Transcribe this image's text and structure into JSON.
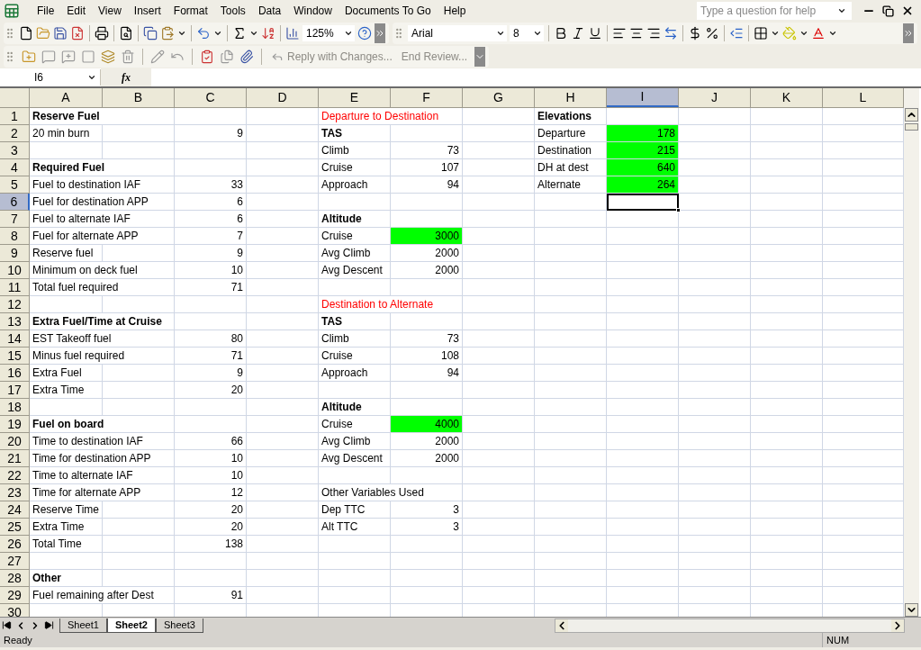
{
  "menu_bar": {
    "items": [
      "File",
      "Edit",
      "View",
      "Insert",
      "Format",
      "Tools",
      "Data",
      "Window",
      "Documents To Go",
      "Help"
    ]
  },
  "help_box": {
    "placeholder": "Type a question for help"
  },
  "standard_toolbar": {
    "zoom": "125%"
  },
  "formatting_toolbar": {
    "font": "Arial",
    "font_size": "8"
  },
  "reviewing_toolbar": {
    "buttons": [
      "Reply with Changes...",
      "End Review..."
    ]
  },
  "formula_bar": {
    "name_box": "I6",
    "function_label": "fx"
  },
  "sheet": {
    "columns": [
      {
        "label": "A",
        "selected": false
      },
      {
        "label": "B",
        "selected": false
      },
      {
        "label": "C",
        "selected": false
      },
      {
        "label": "D",
        "selected": false
      },
      {
        "label": "E",
        "selected": false
      },
      {
        "label": "F",
        "selected": false
      },
      {
        "label": "G",
        "selected": false
      },
      {
        "label": "H",
        "selected": false
      },
      {
        "label": "I",
        "selected": true
      },
      {
        "label": "J",
        "selected": false
      },
      {
        "label": "K",
        "selected": false
      },
      {
        "label": "L",
        "selected": false
      }
    ],
    "rows": [
      {
        "number": "1",
        "selected": false,
        "cells": {
          "a": {
            "text": "Reserve Fuel",
            "kind": "text",
            "bold": true,
            "highlighted": false
          },
          "e": {
            "text": "Departure to Destination",
            "kind": "text",
            "bold": false,
            "highlighted": false,
            "color": "#ff0000"
          },
          "h": {
            "text": "Elevations",
            "kind": "text",
            "bold": true,
            "highlighted": false
          }
        }
      },
      {
        "number": "2",
        "selected": false,
        "cells": {
          "a": {
            "text": "20 min burn",
            "kind": "text",
            "bold": false,
            "highlighted": false
          },
          "c": {
            "text": "9",
            "kind": "number",
            "bold": false,
            "highlighted": false
          },
          "e": {
            "text": "TAS",
            "kind": "text",
            "bold": true,
            "highlighted": false
          },
          "h": {
            "text": "Departure",
            "kind": "text",
            "bold": false,
            "highlighted": false
          },
          "i": {
            "text": "178",
            "kind": "number",
            "bold": false,
            "highlighted": true
          }
        }
      },
      {
        "number": "3",
        "selected": false,
        "cells": {
          "e": {
            "text": "Climb",
            "kind": "text",
            "bold": false,
            "highlighted": false
          },
          "f": {
            "text": "73",
            "kind": "number",
            "bold": false,
            "highlighted": false
          },
          "h": {
            "text": "Destination",
            "kind": "text",
            "bold": false,
            "highlighted": false
          },
          "i": {
            "text": "215",
            "kind": "number",
            "bold": false,
            "highlighted": true
          }
        }
      },
      {
        "number": "4",
        "selected": false,
        "cells": {
          "a": {
            "text": "Required Fuel",
            "kind": "text",
            "bold": true,
            "highlighted": false
          },
          "e": {
            "text": "Cruise",
            "kind": "text",
            "bold": false,
            "highlighted": false
          },
          "f": {
            "text": "107",
            "kind": "number",
            "bold": false,
            "highlighted": false
          },
          "h": {
            "text": "DH at dest",
            "kind": "text",
            "bold": false,
            "highlighted": false
          },
          "i": {
            "text": "640",
            "kind": "number",
            "bold": false,
            "highlighted": true
          }
        }
      },
      {
        "number": "5",
        "selected": false,
        "cells": {
          "a": {
            "text": "Fuel to destination IAF",
            "kind": "text",
            "bold": false,
            "highlighted": false
          },
          "c": {
            "text": "33",
            "kind": "number",
            "bold": false,
            "highlighted": false
          },
          "e": {
            "text": "Approach",
            "kind": "text",
            "bold": false,
            "highlighted": false
          },
          "f": {
            "text": "94",
            "kind": "number",
            "bold": false,
            "highlighted": false
          },
          "h": {
            "text": "Alternate",
            "kind": "text",
            "bold": false,
            "highlighted": false
          },
          "i": {
            "text": "264",
            "kind": "number",
            "bold": false,
            "highlighted": true
          }
        }
      },
      {
        "number": "6",
        "selected": true,
        "cells": {
          "a": {
            "text": "Fuel for destination APP",
            "kind": "text",
            "bold": false,
            "highlighted": false
          },
          "c": {
            "text": "6",
            "kind": "number",
            "bold": false,
            "highlighted": false
          }
        }
      },
      {
        "number": "7",
        "selected": false,
        "cells": {
          "a": {
            "text": "Fuel to alternate IAF",
            "kind": "text",
            "bold": false,
            "highlighted": false
          },
          "c": {
            "text": "6",
            "kind": "number",
            "bold": false,
            "highlighted": false
          },
          "e": {
            "text": "Altitude",
            "kind": "text",
            "bold": true,
            "highlighted": false
          }
        }
      },
      {
        "number": "8",
        "selected": false,
        "cells": {
          "a": {
            "text": "Fuel for alternate APP",
            "kind": "text",
            "bold": false,
            "highlighted": false
          },
          "c": {
            "text": "7",
            "kind": "number",
            "bold": false,
            "highlighted": false
          },
          "e": {
            "text": "Cruise",
            "kind": "text",
            "bold": false,
            "highlighted": false
          },
          "f": {
            "text": "3000",
            "kind": "number",
            "bold": false,
            "highlighted": true
          }
        }
      },
      {
        "number": "9",
        "selected": false,
        "cells": {
          "a": {
            "text": "Reserve fuel",
            "kind": "text",
            "bold": false,
            "highlighted": false
          },
          "c": {
            "text": "9",
            "kind": "number",
            "bold": false,
            "highlighted": false
          },
          "e": {
            "text": "Avg Climb",
            "kind": "text",
            "bold": false,
            "highlighted": false
          },
          "f": {
            "text": "2000",
            "kind": "number",
            "bold": false,
            "highlighted": false
          }
        }
      },
      {
        "number": "10",
        "selected": false,
        "cells": {
          "a": {
            "text": "Minimum on deck fuel",
            "kind": "text",
            "bold": false,
            "highlighted": false
          },
          "c": {
            "text": "10",
            "kind": "number",
            "bold": false,
            "highlighted": false
          },
          "e": {
            "text": "Avg Descent",
            "kind": "text",
            "bold": false,
            "highlighted": false
          },
          "f": {
            "text": "2000",
            "kind": "number",
            "bold": false,
            "highlighted": false
          }
        }
      },
      {
        "number": "11",
        "selected": false,
        "cells": {
          "a": {
            "text": "Total fuel required",
            "kind": "text",
            "bold": false,
            "highlighted": false
          },
          "c": {
            "text": "71",
            "kind": "number",
            "bold": false,
            "highlighted": false
          }
        }
      },
      {
        "number": "12",
        "selected": false,
        "cells": {
          "e": {
            "text": "Destination to Alternate",
            "kind": "text",
            "bold": false,
            "highlighted": false,
            "color": "#ff0000"
          }
        }
      },
      {
        "number": "13",
        "selected": false,
        "cells": {
          "a": {
            "text": "Extra Fuel/Time at Cruise",
            "kind": "text",
            "bold": true,
            "highlighted": false
          },
          "e": {
            "text": "TAS",
            "kind": "text",
            "bold": true,
            "highlighted": false
          }
        }
      },
      {
        "number": "14",
        "selected": false,
        "cells": {
          "a": {
            "text": "EST Takeoff fuel",
            "kind": "text",
            "bold": false,
            "highlighted": false
          },
          "c": {
            "text": "80",
            "kind": "number",
            "bold": false,
            "highlighted": false
          },
          "e": {
            "text": "Climb",
            "kind": "text",
            "bold": false,
            "highlighted": false
          },
          "f": {
            "text": "73",
            "kind": "number",
            "bold": false,
            "highlighted": false
          }
        }
      },
      {
        "number": "15",
        "selected": false,
        "cells": {
          "a": {
            "text": "Minus fuel required",
            "kind": "text",
            "bold": false,
            "highlighted": false
          },
          "c": {
            "text": "71",
            "kind": "number",
            "bold": false,
            "highlighted": false
          },
          "e": {
            "text": "Cruise",
            "kind": "text",
            "bold": false,
            "highlighted": false
          },
          "f": {
            "text": "108",
            "kind": "number",
            "bold": false,
            "highlighted": false
          }
        }
      },
      {
        "number": "16",
        "selected": false,
        "cells": {
          "a": {
            "text": "Extra Fuel",
            "kind": "text",
            "bold": false,
            "highlighted": false
          },
          "c": {
            "text": "9",
            "kind": "number",
            "bold": false,
            "highlighted": false
          },
          "e": {
            "text": "Approach",
            "kind": "text",
            "bold": false,
            "highlighted": false
          },
          "f": {
            "text": "94",
            "kind": "number",
            "bold": false,
            "highlighted": false
          }
        }
      },
      {
        "number": "17",
        "selected": false,
        "cells": {
          "a": {
            "text": "Extra Time",
            "kind": "text",
            "bold": false,
            "highlighted": false
          },
          "c": {
            "text": "20",
            "kind": "number",
            "bold": false,
            "highlighted": false
          }
        }
      },
      {
        "number": "18",
        "selected": false,
        "cells": {
          "e": {
            "text": "Altitude",
            "kind": "text",
            "bold": true,
            "highlighted": false
          }
        }
      },
      {
        "number": "19",
        "selected": false,
        "cells": {
          "a": {
            "text": "Fuel on board",
            "kind": "text",
            "bold": true,
            "highlighted": false
          },
          "e": {
            "text": "Cruise",
            "kind": "text",
            "bold": false,
            "highlighted": false
          },
          "f": {
            "text": "4000",
            "kind": "number",
            "bold": false,
            "highlighted": true
          }
        }
      },
      {
        "number": "20",
        "selected": false,
        "cells": {
          "a": {
            "text": "Time to destination IAF",
            "kind": "text",
            "bold": false,
            "highlighted": false
          },
          "c": {
            "text": "66",
            "kind": "number",
            "bold": false,
            "highlighted": false
          },
          "e": {
            "text": "Avg Climb",
            "kind": "text",
            "bold": false,
            "highlighted": false
          },
          "f": {
            "text": "2000",
            "kind": "number",
            "bold": false,
            "highlighted": false
          }
        }
      },
      {
        "number": "21",
        "selected": false,
        "cells": {
          "a": {
            "text": "Time for destination APP",
            "kind": "text",
            "bold": false,
            "highlighted": false
          },
          "c": {
            "text": "10",
            "kind": "number",
            "bold": false,
            "highlighted": false
          },
          "e": {
            "text": "Avg Descent",
            "kind": "text",
            "bold": false,
            "highlighted": false
          },
          "f": {
            "text": "2000",
            "kind": "number",
            "bold": false,
            "highlighted": false
          }
        }
      },
      {
        "number": "22",
        "selected": false,
        "cells": {
          "a": {
            "text": "Time to alternate IAF",
            "kind": "text",
            "bold": false,
            "highlighted": false
          },
          "c": {
            "text": "10",
            "kind": "number",
            "bold": false,
            "highlighted": false
          }
        }
      },
      {
        "number": "23",
        "selected": false,
        "cells": {
          "a": {
            "text": "Time for alternate APP",
            "kind": "text",
            "bold": false,
            "highlighted": false
          },
          "c": {
            "text": "12",
            "kind": "number",
            "bold": false,
            "highlighted": false
          },
          "e": {
            "text": "Other Variables Used",
            "kind": "text",
            "bold": false,
            "highlighted": false
          }
        }
      },
      {
        "number": "24",
        "selected": false,
        "cells": {
          "a": {
            "text": "Reserve Time",
            "kind": "text",
            "bold": false,
            "highlighted": false
          },
          "c": {
            "text": "20",
            "kind": "number",
            "bold": false,
            "highlighted": false
          },
          "e": {
            "text": "Dep TTC",
            "kind": "text",
            "bold": false,
            "highlighted": false
          },
          "f": {
            "text": "3",
            "kind": "number",
            "bold": false,
            "highlighted": false
          }
        }
      },
      {
        "number": "25",
        "selected": false,
        "cells": {
          "a": {
            "text": "Extra Time",
            "kind": "text",
            "bold": false,
            "highlighted": false
          },
          "c": {
            "text": "20",
            "kind": "number",
            "bold": false,
            "highlighted": false
          },
          "e": {
            "text": "Alt TTC",
            "kind": "text",
            "bold": false,
            "highlighted": false
          },
          "f": {
            "text": "3",
            "kind": "number",
            "bold": false,
            "highlighted": false
          }
        }
      },
      {
        "number": "26",
        "selected": false,
        "cells": {
          "a": {
            "text": "Total Time",
            "kind": "text",
            "bold": false,
            "highlighted": false
          },
          "c": {
            "text": "138",
            "kind": "number",
            "bold": false,
            "highlighted": false
          }
        }
      },
      {
        "number": "27",
        "selected": false,
        "cells": {}
      },
      {
        "number": "28",
        "selected": false,
        "cells": {
          "a": {
            "text": "Other",
            "kind": "text",
            "bold": true,
            "highlighted": false
          }
        }
      },
      {
        "number": "29",
        "selected": false,
        "cells": {
          "a": {
            "text": "Fuel remaining after Dest",
            "kind": "text",
            "bold": false,
            "highlighted": false
          },
          "c": {
            "text": "91",
            "kind": "number",
            "bold": false,
            "highlighted": false
          }
        }
      },
      {
        "number": "30",
        "selected": false,
        "cells": {}
      }
    ]
  },
  "sheet_tabs": [
    {
      "label": "Sheet1",
      "selected": false
    },
    {
      "label": "Sheet2",
      "selected": true
    },
    {
      "label": "Sheet3",
      "selected": false
    }
  ],
  "status_bar": {
    "text": "Ready",
    "indicators": [
      "NUM"
    ]
  }
}
